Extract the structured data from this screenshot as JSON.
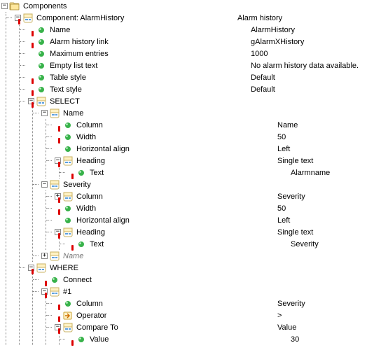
{
  "root": {
    "label": "Components"
  },
  "component": {
    "label": "Component: AlarmHistory",
    "value": "Alarm history",
    "props": {
      "name": {
        "label": "Name",
        "value": "AlarmHistory"
      },
      "histlnk": {
        "label": "Alarm history link",
        "value": "gAlarmXHistory"
      },
      "maxent": {
        "label": "Maximum entries",
        "value": "1000"
      },
      "empty": {
        "label": "Empty list text",
        "value": "No alarm history data available."
      },
      "tstyle": {
        "label": "Table style",
        "value": "Default"
      },
      "xstyle": {
        "label": "Text style",
        "value": "Default"
      }
    }
  },
  "select": {
    "label": "SELECT",
    "nameGroup": {
      "label": "Name"
    },
    "severityGroup": {
      "label": "Severity"
    },
    "nameGrayGroup": {
      "label": "Name"
    },
    "col1": {
      "column": {
        "label": "Column",
        "value": "Name"
      },
      "width": {
        "label": "Width",
        "value": "50"
      },
      "halign": {
        "label": "Horizontal align",
        "value": "Left"
      },
      "heading": {
        "label": "Heading",
        "value": "Single text"
      },
      "text": {
        "label": "Text",
        "value": "Alarmname"
      }
    },
    "col2": {
      "column": {
        "label": "Column",
        "value": "Severity"
      },
      "width": {
        "label": "Width",
        "value": "50"
      },
      "halign": {
        "label": "Horizontal align",
        "value": "Left"
      },
      "heading": {
        "label": "Heading",
        "value": "Single text"
      },
      "text": {
        "label": "Text",
        "value": "Severity"
      }
    }
  },
  "where": {
    "label": "WHERE",
    "connect": {
      "label": "Connect"
    },
    "item1": {
      "label": "#1",
      "column": {
        "label": "Column",
        "value": "Severity"
      },
      "operator": {
        "label": "Operator",
        "value": ">"
      },
      "compare": {
        "label": "Compare To",
        "value": "Value"
      },
      "value": {
        "label": "Value",
        "value": "30"
      }
    }
  }
}
